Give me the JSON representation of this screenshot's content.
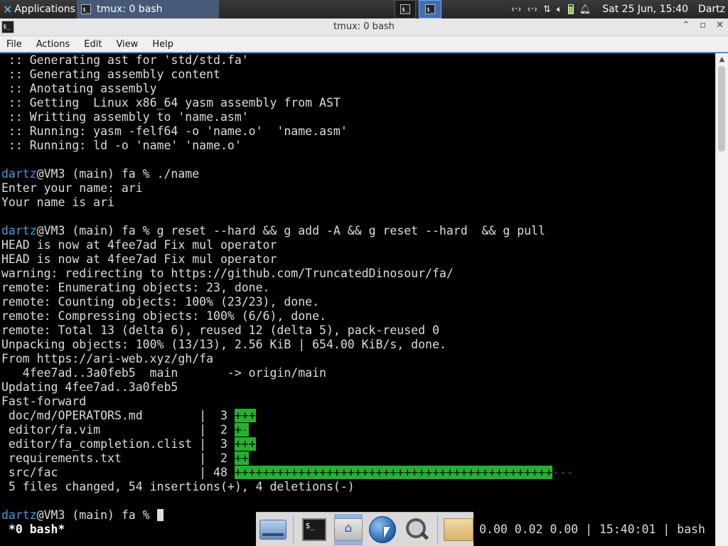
{
  "panel": {
    "apps_label": "Applications",
    "task_title": "tmux: 0 bash",
    "clock": "Sat 25 Jun, 15:40",
    "user": "Dartz",
    "term_glyph": "$_"
  },
  "window": {
    "title": "tmux: 0 bash",
    "minimize": "⌃",
    "restore": "▫",
    "close": "✕"
  },
  "menu": [
    "File",
    "Actions",
    "Edit",
    "View",
    "Help"
  ],
  "terminal": {
    "lines": [
      " :: Generating ast for 'std/std.fa'",
      " :: Generating assembly content",
      " :: Anotating assembly",
      " :: Getting  Linux x86_64 yasm assembly from AST",
      " :: Writting assembly to 'name.asm'",
      " :: Running: yasm -felf64 -o 'name.o'  'name.asm'",
      " :: Running: ld -o 'name' 'name.o'",
      "",
      {
        "user": "dartz",
        "prompt": "@VM3 (main) fa % ",
        "cmd": "./name"
      },
      "Enter your name: ari",
      "Your name is ari",
      "",
      {
        "user": "dartz",
        "prompt": "@VM3 (main) fa % ",
        "cmd": "g reset --hard && g add -A && g reset --hard  && g pull"
      },
      "HEAD is now at 4fee7ad Fix mul operator",
      "HEAD is now at 4fee7ad Fix mul operator",
      "warning: redirecting to https://github.com/TruncatedDinosour/fa/",
      "remote: Enumerating objects: 23, done.",
      "remote: Counting objects: 100% (23/23), done.",
      "remote: Compressing objects: 100% (6/6), done.",
      "remote: Total 13 (delta 6), reused 12 (delta 5), pack-reused 0",
      "Unpacking objects: 100% (13/13), 2.56 KiB | 654.00 KiB/s, done.",
      "From https://ari-web.xyz/gh/fa",
      "   4fee7ad..3a0feb5  main       -> origin/main",
      "Updating 4fee7ad..3a0feb5",
      "Fast-forward",
      {
        "stat": " doc/md/OPERATORS.md        |  3 ",
        "plus": "+++",
        "minus": ""
      },
      {
        "stat": " editor/fa.vim              |  2 ",
        "plus": "+",
        "minus": "-"
      },
      {
        "stat": " editor/fa_completion.clist |  3 ",
        "plus": "+++",
        "minus": ""
      },
      {
        "stat": " requirements.txt           |  2 ",
        "plus": "++",
        "minus": ""
      },
      {
        "stat": " src/fac                    | 48 ",
        "plus": "+++++++++++++++++++++++++++++++++++++++++++++",
        "minus": "---"
      },
      " 5 files changed, 54 insertions(+), 4 deletions(-)",
      "",
      {
        "user": "dartz",
        "prompt": "@VM3 (main) fa % ",
        "cmd": "",
        "cursor": true
      }
    ],
    "status_left": " *0 bash*",
    "status_right": "0.00 0.02 0.00 | 15:40:01 | bash"
  },
  "dock": {
    "items": [
      "drive-icon",
      "terminal-icon",
      "home-folder-icon",
      "web-browser-icon",
      "search-icon",
      "folder-icon"
    ],
    "active": "home-folder-icon"
  },
  "colors": {
    "prompt_user": "#3aa0e0",
    "diff_plus_bg": "#22b22e",
    "diff_minus": "#b51f1f",
    "accent": "#4a8fd8"
  }
}
